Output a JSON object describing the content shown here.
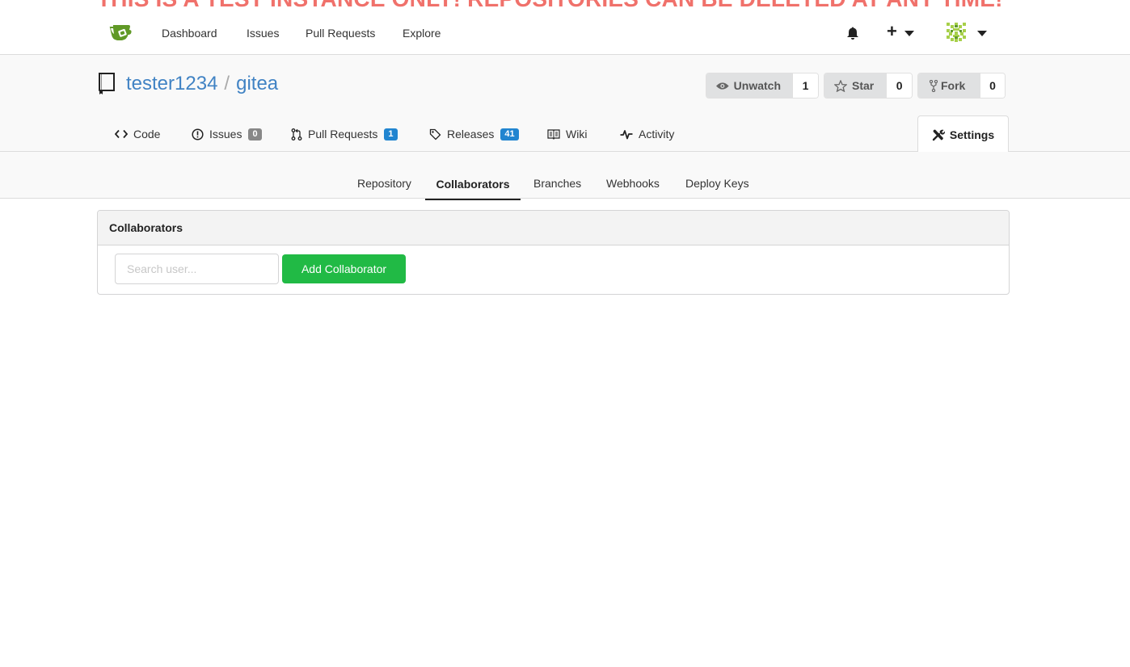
{
  "banner": {
    "text": "THIS IS A TEST INSTANCE ONLY! REPOSITORIES CAN BE DELETED AT ANY TIME!",
    "color": "#f0716b"
  },
  "topnav": {
    "logo": "gitea-logo-icon",
    "items": [
      "Dashboard",
      "Issues",
      "Pull Requests",
      "Explore"
    ],
    "notification_icon": "bell-icon",
    "create_icon": "plus-icon",
    "avatar_icon": "identicon-avatar"
  },
  "repo": {
    "owner": "tester1234",
    "separator": "/",
    "name": "gitea",
    "watch": {
      "label": "Unwatch",
      "count": "1"
    },
    "star": {
      "label": "Star",
      "count": "0"
    },
    "fork": {
      "label": "Fork",
      "count": "0"
    }
  },
  "tabs": {
    "code": {
      "label": "Code"
    },
    "issues": {
      "label": "Issues",
      "badge": "0",
      "badge_color": "#888888"
    },
    "pulls": {
      "label": "Pull Requests",
      "badge": "1",
      "badge_color": "#2185d0"
    },
    "releases": {
      "label": "Releases",
      "badge": "41",
      "badge_color": "#2185d0"
    },
    "wiki": {
      "label": "Wiki"
    },
    "activity": {
      "label": "Activity"
    },
    "settings": {
      "label": "Settings"
    }
  },
  "settings_nav": {
    "items": [
      "Repository",
      "Collaborators",
      "Branches",
      "Webhooks",
      "Deploy Keys"
    ],
    "active": "Collaborators"
  },
  "collaborators": {
    "title": "Collaborators",
    "search_placeholder": "Search user...",
    "add_button": "Add Collaborator",
    "accent": "#21ba45"
  }
}
